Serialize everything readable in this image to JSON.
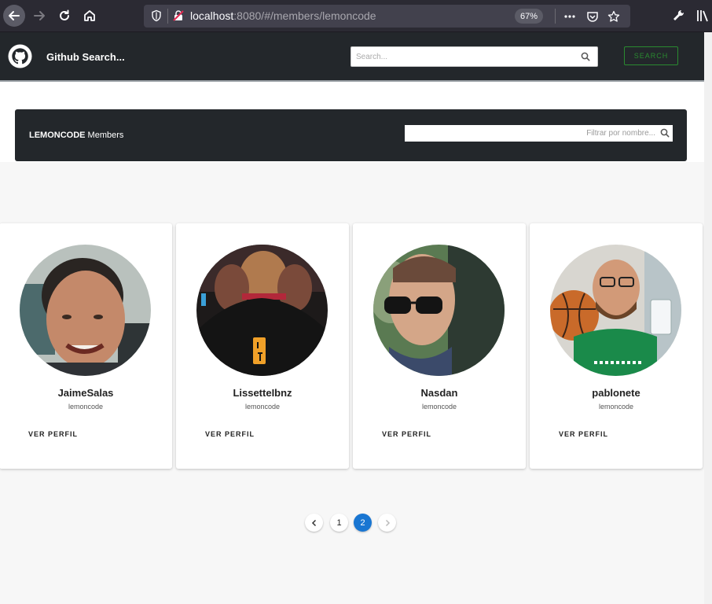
{
  "browser": {
    "url_host": "localhost",
    "url_rest": ":8080/#/members/lemoncode",
    "zoom": "67%"
  },
  "app": {
    "title": "Github Search...",
    "search_placeholder": "Search...",
    "search_button": "SEARCH"
  },
  "members_panel": {
    "org": "LEMONCODE",
    "suffix": " Members",
    "filter_placeholder": "Filtrar por nombre..."
  },
  "members": [
    {
      "name": "JaimeSalas",
      "org": "lemoncode",
      "action": "VER PERFIL"
    },
    {
      "name": "LissetteIbnz",
      "org": "lemoncode",
      "action": "VER PERFIL"
    },
    {
      "name": "Nasdan",
      "org": "lemoncode",
      "action": "VER PERFIL"
    },
    {
      "name": "pablonete",
      "org": "lemoncode",
      "action": "VER PERFIL"
    }
  ],
  "pagination": {
    "pages": [
      "1",
      "2"
    ],
    "current": "2"
  },
  "colors": {
    "header_bg": "#23272b",
    "accent_green": "#2a8a30",
    "active_page": "#1976d2"
  }
}
